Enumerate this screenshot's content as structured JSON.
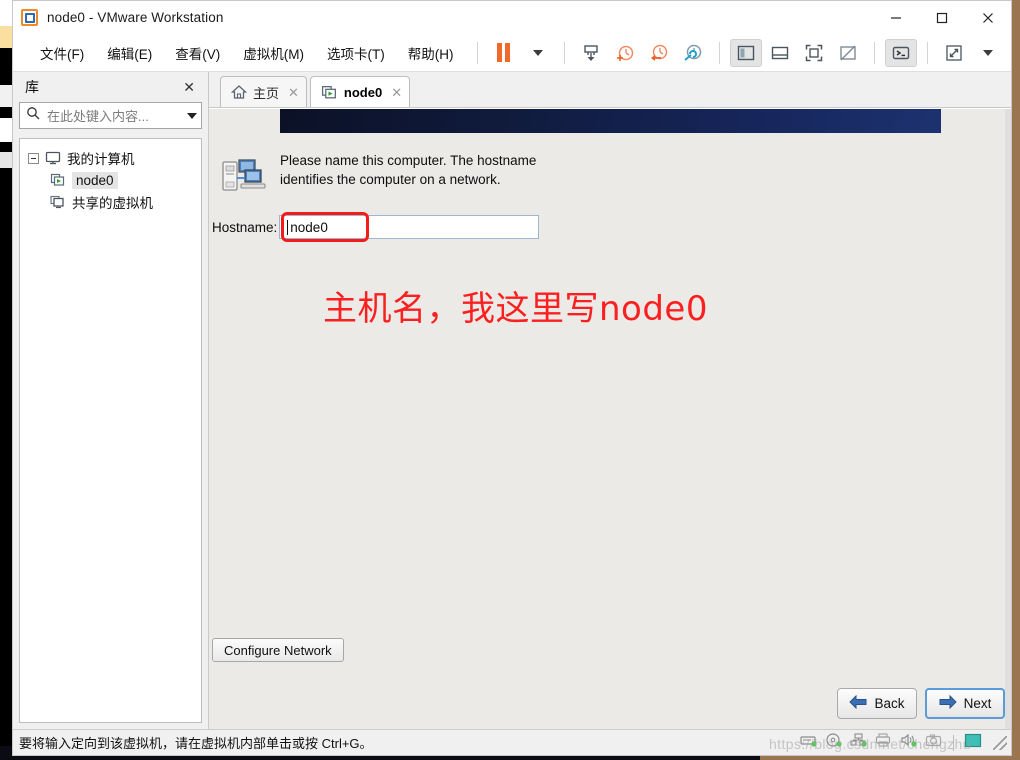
{
  "window": {
    "title": "node0 - VMware Workstation",
    "logo_icon": "vmware-logo-icon",
    "minimize_label": "—",
    "maximize_label": "☐",
    "close_label": "✕"
  },
  "menubar": {
    "items": [
      {
        "label": "文件(F)",
        "name": "menu-file"
      },
      {
        "label": "编辑(E)",
        "name": "menu-edit"
      },
      {
        "label": "查看(V)",
        "name": "menu-view"
      },
      {
        "label": "虚拟机(M)",
        "name": "menu-vm"
      },
      {
        "label": "选项卡(T)",
        "name": "menu-tabs"
      },
      {
        "label": "帮助(H)",
        "name": "menu-help"
      }
    ]
  },
  "toolbar": {
    "buttons": [
      {
        "name": "suspend-icon",
        "title": "挂起"
      },
      {
        "name": "chevron-down-icon",
        "title": "更多"
      },
      {
        "name": "send-ctrl-alt-del-icon",
        "title": "发送 Ctrl+Alt+Del"
      },
      {
        "name": "snapshot-take-icon",
        "title": "捕获快照"
      },
      {
        "name": "snapshot-revert-icon",
        "title": "恢复快照"
      },
      {
        "name": "snapshot-manager-icon",
        "title": "快照管理器"
      },
      {
        "name": "show-library-icon",
        "title": "显示库"
      },
      {
        "name": "show-thumbnails-icon",
        "title": "显示缩略图"
      },
      {
        "name": "fullscreen-icon",
        "title": "全屏"
      },
      {
        "name": "unity-mode-icon",
        "title": "Unity 模式"
      },
      {
        "name": "console-icon",
        "title": "控制台"
      },
      {
        "name": "stretch-icon",
        "title": "拉伸"
      },
      {
        "name": "stretch-chevron-icon",
        "title": "更多"
      }
    ]
  },
  "sidebar": {
    "title": "库",
    "close_label": "✕",
    "search": {
      "placeholder": "在此处键入内容...",
      "value": "",
      "icon": "search-icon"
    },
    "tree": [
      {
        "label": "我的计算机",
        "icon": "monitor-icon",
        "level": 1,
        "expanded": true,
        "selected": false
      },
      {
        "label": "node0",
        "icon": "vm-running-icon",
        "level": 2,
        "expanded": false,
        "selected": true
      },
      {
        "label": "共享的虚拟机",
        "icon": "shared-vm-icon",
        "level": 1,
        "expanded": false,
        "selected": false
      }
    ]
  },
  "tabs": [
    {
      "label": "主页",
      "icon": "home-icon",
      "active": false,
      "close_label": "✕"
    },
    {
      "label": "node0",
      "icon": "vm-running-icon",
      "active": true,
      "close_label": "✕"
    }
  ],
  "vm_screen": {
    "installer_icon": "computers-network-icon",
    "description": "Please name this computer.  The hostname identifies the computer on a network.",
    "hostname_label": "Hostname:",
    "hostname_value": "node0",
    "configure_network_label": "Configure Network",
    "back_label": "Back",
    "next_label": "Next",
    "back_icon": "arrow-left-icon",
    "next_icon": "arrow-right-icon",
    "annotation_text": "主机名，我这里写node0",
    "annotation_color": "#fb2020",
    "highlight_box_color": "#f41b1b",
    "header_band_color": "#16255a"
  },
  "statusbar": {
    "message": "要将输入定向到该虚拟机，请在虚拟机内部单击或按 Ctrl+G。",
    "watermark": "https://blog.csdn.net/chengzhu",
    "devices": [
      {
        "name": "hard-disk-icon",
        "connected": true
      },
      {
        "name": "cd-dvd-icon",
        "connected": true
      },
      {
        "name": "network-adapter-icon",
        "connected": true
      },
      {
        "name": "printer-icon",
        "connected": false
      },
      {
        "name": "sound-card-icon",
        "connected": true
      },
      {
        "name": "camera-icon",
        "connected": false
      },
      {
        "name": "display-icon",
        "connected": true
      }
    ],
    "grip_icon": "resize-grip-icon"
  }
}
